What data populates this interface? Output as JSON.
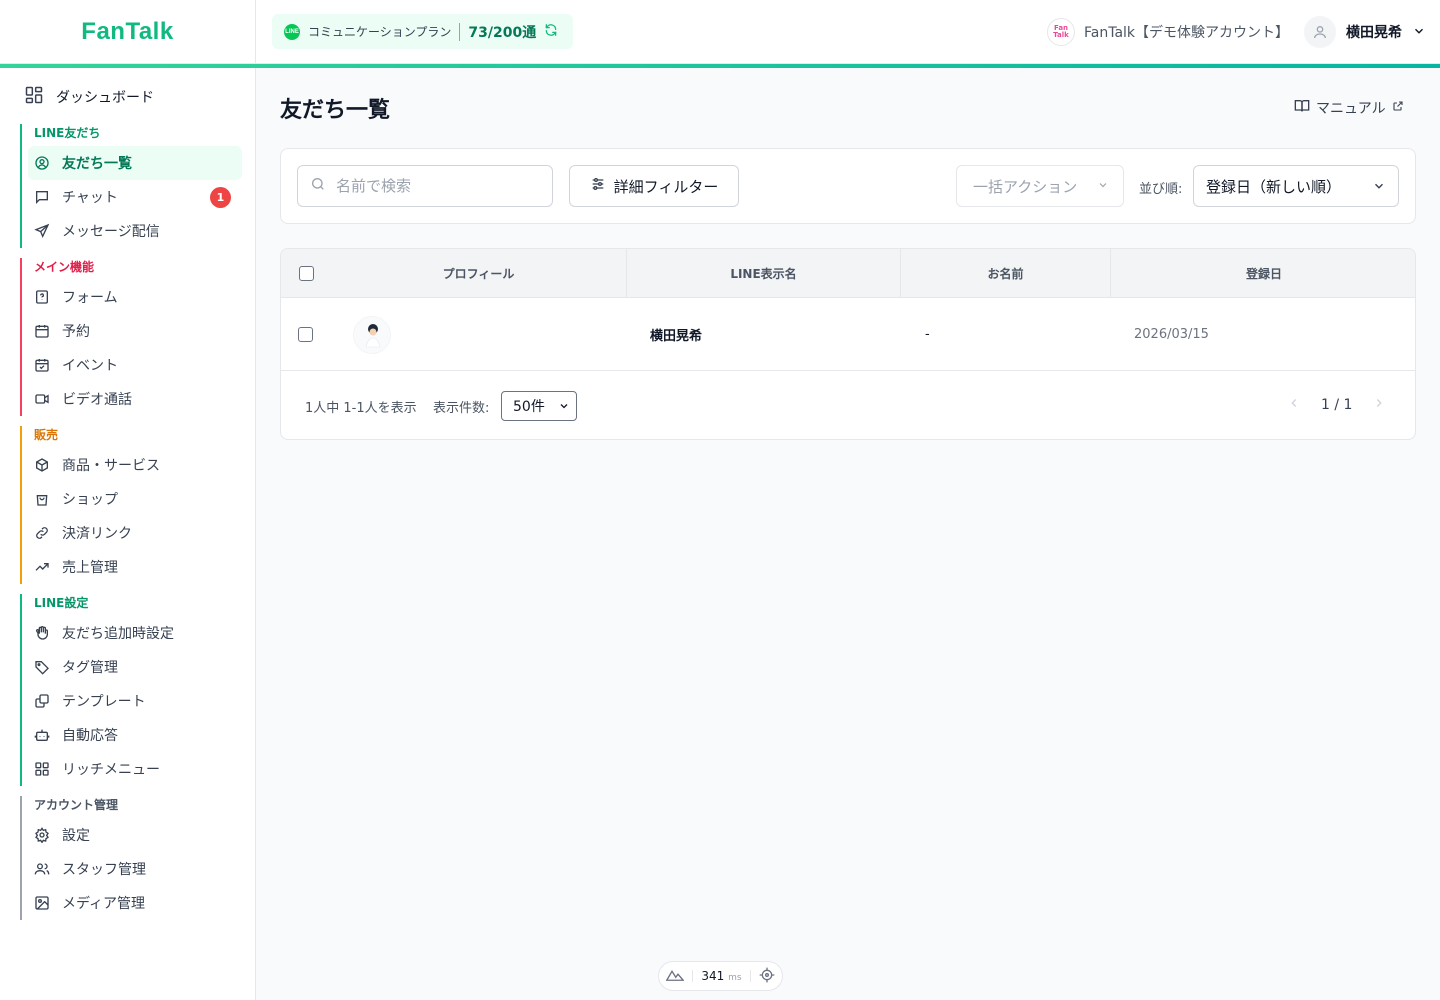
{
  "header": {
    "logo": "FanTalk",
    "plan_name": "コミュニケーションプラン",
    "plan_usage": "73/200通",
    "account_logo_line1": "Fan",
    "account_logo_line2": "Talk",
    "account_name": "FanTalk【デモ体験アカウント】",
    "user_name": "横田晃希",
    "line_icon_text": "LINE"
  },
  "sidebar": {
    "dashboard": "ダッシュボード",
    "sections": [
      {
        "title": "LINE友だち",
        "color": "#059669",
        "items": [
          {
            "label": "友だち一覧",
            "icon": "user-circle-icon",
            "active": true
          },
          {
            "label": "チャット",
            "icon": "chat-icon",
            "badge": "1"
          },
          {
            "label": "メッセージ配信",
            "icon": "send-icon"
          }
        ]
      },
      {
        "title": "メイン機能",
        "color": "#e11d48",
        "items": [
          {
            "label": "フォーム",
            "icon": "form-icon"
          },
          {
            "label": "予約",
            "icon": "calendar-icon"
          },
          {
            "label": "イベント",
            "icon": "calendar-check-icon"
          },
          {
            "label": "ビデオ通話",
            "icon": "video-icon"
          }
        ]
      },
      {
        "title": "販売",
        "color": "#d97706",
        "items": [
          {
            "label": "商品・サービス",
            "icon": "box-icon"
          },
          {
            "label": "ショップ",
            "icon": "shopping-bag-icon"
          },
          {
            "label": "決済リンク",
            "icon": "link-icon"
          },
          {
            "label": "売上管理",
            "icon": "trending-up-icon"
          }
        ]
      },
      {
        "title": "LINE設定",
        "color": "#059669",
        "items": [
          {
            "label": "友だち追加時設定",
            "icon": "hand-icon"
          },
          {
            "label": "タグ管理",
            "icon": "tag-icon"
          },
          {
            "label": "テンプレート",
            "icon": "copy-icon"
          },
          {
            "label": "自動応答",
            "icon": "bot-icon"
          },
          {
            "label": "リッチメニュー",
            "icon": "grid-icon"
          }
        ]
      },
      {
        "title": "アカウント管理",
        "color": "#6b7280",
        "items": [
          {
            "label": "設定",
            "icon": "gear-icon"
          },
          {
            "label": "スタッフ管理",
            "icon": "users-icon"
          },
          {
            "label": "メディア管理",
            "icon": "image-icon"
          }
        ]
      }
    ]
  },
  "main": {
    "title": "友だち一覧",
    "manual_label": "マニュアル",
    "search_placeholder": "名前で検索",
    "filter_label": "詳細フィルター",
    "bulk_action": "一括アクション",
    "sort_label": "並び順:",
    "sort_value": "登録日（新しい順）",
    "table": {
      "headers": [
        "プロフィール",
        "LINE表示名",
        "お名前",
        "登録日"
      ],
      "rows": [
        {
          "line_name": "横田晃希",
          "name": "-",
          "registered": "2026/03/15"
        }
      ]
    },
    "count_text": "1人中 1-1人を表示",
    "per_page_label": "表示件数:",
    "per_page_value": "50件",
    "page_indicator": "1 / 1"
  },
  "perf": {
    "value": "341",
    "unit": "ms"
  }
}
